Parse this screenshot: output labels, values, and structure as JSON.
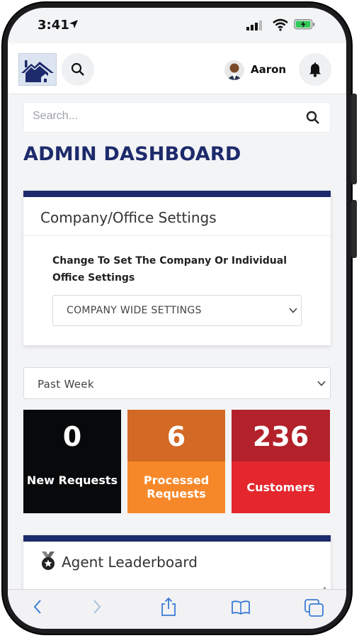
{
  "status_bar": {
    "time": "3:41"
  },
  "header": {
    "user_name": "Aaron"
  },
  "search": {
    "placeholder": "Search..."
  },
  "page": {
    "title": "ADMIN DASHBOARD"
  },
  "settings_card": {
    "title": "Company/Office Settings",
    "label": "Change To Set The Company Or Individual Office Settings",
    "selected_value": "COMPANY WIDE SETTINGS"
  },
  "period_select": {
    "selected_value": "Past Week"
  },
  "stats": [
    {
      "value": "0",
      "label": "New Requests"
    },
    {
      "value": "6",
      "label": "Processed Requests"
    },
    {
      "value": "236",
      "label": "Customers"
    }
  ],
  "leaderboard": {
    "title": "Agent Leaderboard"
  },
  "colors": {
    "brand_navy": "#1d2a6b",
    "new_requests": "#08090b",
    "processed_top": "#d26a25",
    "processed_bottom": "#f7882a",
    "customers_top": "#b3212a",
    "customers_bottom": "#e3272d"
  },
  "icons": {
    "location": "location-arrow-icon",
    "signal": "signal-icon",
    "wifi": "wifi-icon",
    "battery": "battery-charging-icon",
    "search": "search-icon",
    "bell": "bell-icon",
    "medal": "medal-icon",
    "back": "back-arrow-icon",
    "forward": "forward-arrow-icon",
    "share": "share-icon",
    "bookmarks": "bookmarks-icon",
    "tabs": "tabs-icon"
  }
}
